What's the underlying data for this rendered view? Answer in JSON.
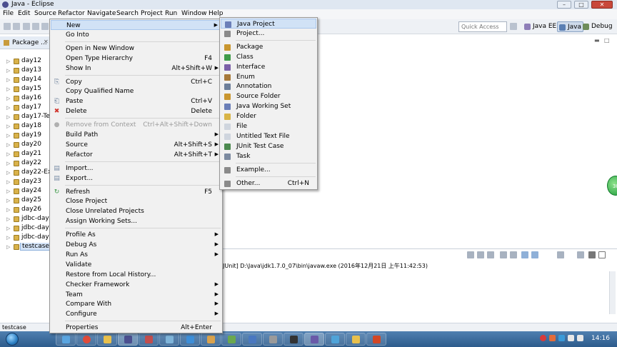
{
  "window": {
    "title": "Java - Eclipse",
    "min": "–",
    "max": "□",
    "close": "✕"
  },
  "menubar": [
    "File",
    "Edit",
    "Source",
    "Refactor",
    "Navigate",
    "Search",
    "Project",
    "Run",
    "Window",
    "Help"
  ],
  "toolbar": {
    "quick_access_placeholder": "Quick Access",
    "perspectives": [
      "Java EE",
      "Java",
      "Debug"
    ]
  },
  "package_explorer": {
    "tab_label": "Package ...",
    "close": "✕",
    "items": [
      "day12",
      "day13",
      "day14",
      "day15",
      "day16",
      "day17",
      "day17-Tea",
      "day18",
      "day19",
      "day20",
      "day21",
      "day22",
      "day22-Exa",
      "day23",
      "day24",
      "day25",
      "day26",
      "jdbc-day0",
      "jdbc-day0",
      "jdbc-day0",
      "testcase"
    ],
    "selected": "testcase"
  },
  "context_menu": {
    "items": [
      {
        "label": "New",
        "shortcut": "",
        "submenu": true
      },
      {
        "label": "Go Into",
        "shortcut": ""
      },
      {
        "sep": true
      },
      {
        "label": "Open in New Window",
        "shortcut": ""
      },
      {
        "label": "Open Type Hierarchy",
        "shortcut": "F4"
      },
      {
        "label": "Show In",
        "shortcut": "Alt+Shift+W",
        "submenu": true
      },
      {
        "sep": true
      },
      {
        "label": "Copy",
        "shortcut": "Ctrl+C"
      },
      {
        "label": "Copy Qualified Name",
        "shortcut": ""
      },
      {
        "label": "Paste",
        "shortcut": "Ctrl+V"
      },
      {
        "label": "Delete",
        "shortcut": "Delete"
      },
      {
        "sep": true
      },
      {
        "label": "Remove from Context",
        "shortcut": "Ctrl+Alt+Shift+Down",
        "disabled": true
      },
      {
        "label": "Build Path",
        "shortcut": "",
        "submenu": true
      },
      {
        "label": "Source",
        "shortcut": "Alt+Shift+S",
        "submenu": true
      },
      {
        "label": "Refactor",
        "shortcut": "Alt+Shift+T",
        "submenu": true
      },
      {
        "sep": true
      },
      {
        "label": "Import...",
        "shortcut": ""
      },
      {
        "label": "Export...",
        "shortcut": ""
      },
      {
        "sep": true
      },
      {
        "label": "Refresh",
        "shortcut": "F5"
      },
      {
        "label": "Close Project",
        "shortcut": ""
      },
      {
        "label": "Close Unrelated Projects",
        "shortcut": ""
      },
      {
        "label": "Assign Working Sets...",
        "shortcut": ""
      },
      {
        "sep": true
      },
      {
        "label": "Profile As",
        "shortcut": "",
        "submenu": true
      },
      {
        "label": "Debug As",
        "shortcut": "",
        "submenu": true
      },
      {
        "label": "Run As",
        "shortcut": "",
        "submenu": true
      },
      {
        "label": "Validate",
        "shortcut": ""
      },
      {
        "label": "Restore from Local History...",
        "shortcut": ""
      },
      {
        "label": "Checker Framework",
        "shortcut": "",
        "submenu": true
      },
      {
        "label": "Team",
        "shortcut": "",
        "submenu": true
      },
      {
        "label": "Compare With",
        "shortcut": "",
        "submenu": true
      },
      {
        "label": "Configure",
        "shortcut": "",
        "submenu": true
      },
      {
        "sep": true
      },
      {
        "label": "Properties",
        "shortcut": "Alt+Enter"
      }
    ]
  },
  "new_submenu": {
    "items": [
      {
        "label": "Java Project",
        "color": "#6b7fb8"
      },
      {
        "label": "Project...",
        "color": "#8a8a8a"
      },
      {
        "sep": true
      },
      {
        "label": "Package",
        "color": "#c9962f"
      },
      {
        "label": "Class",
        "color": "#3f9b4a"
      },
      {
        "label": "Interface",
        "color": "#7b5fa8"
      },
      {
        "label": "Enum",
        "color": "#a7793a"
      },
      {
        "label": "Annotation",
        "color": "#6d7f9a"
      },
      {
        "label": "Source Folder",
        "color": "#c9962f"
      },
      {
        "label": "Java Working Set",
        "color": "#6b7fb8"
      },
      {
        "label": "Folder",
        "color": "#d8b446"
      },
      {
        "label": "File",
        "color": "#cfd5de"
      },
      {
        "label": "Untitled Text File",
        "color": "#cfd5de"
      },
      {
        "label": "JUnit Test Case",
        "color": "#4d8a4f"
      },
      {
        "label": "Task",
        "color": "#7c8aa0"
      },
      {
        "sep": true
      },
      {
        "label": "Example...",
        "color": "#8a8a8a"
      },
      {
        "sep": true
      },
      {
        "label": "Other...",
        "shortcut": "Ctrl+N",
        "color": "#8a8a8a"
      }
    ]
  },
  "console": {
    "text": "JUnit] D:\\Java\\jdk1.7.0_07\\bin\\javaw.exe (2016年12月21日 上午11:42:53)"
  },
  "statusbar": {
    "text": "testcase"
  },
  "taskbar": {
    "clock": "14:16",
    "badge": "38"
  }
}
